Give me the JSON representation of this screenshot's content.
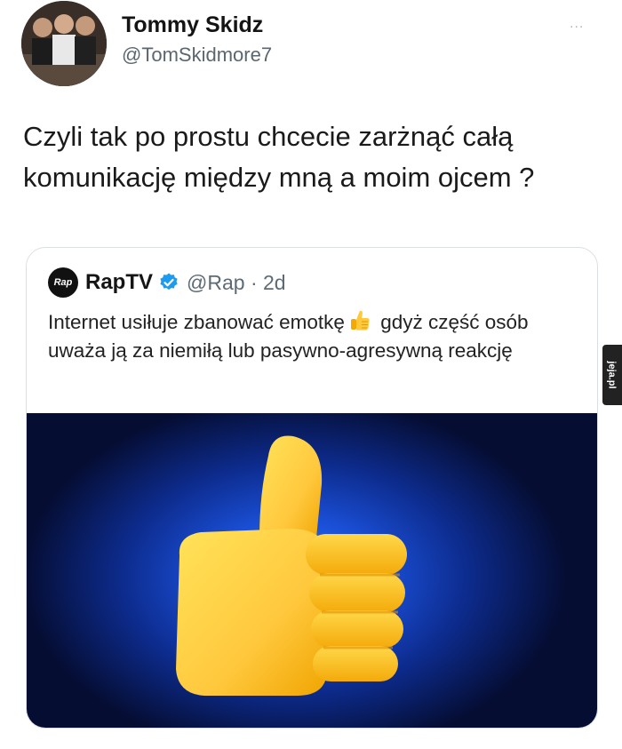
{
  "author": {
    "name": "Tommy Skidz",
    "handle": "@TomSkidmore7"
  },
  "more_menu": "...",
  "tweet": {
    "text": "Czyli tak po prostu chcecie zarżnąć całą komunikację między mną a moim ojcem ?"
  },
  "quoted_tweet": {
    "logo_text": "Rap",
    "name": "RapTV",
    "handle_time": "@Rap · 2d",
    "text_before_emoji": "Internet usiłuje zbanować emotkę",
    "text_after_emoji": " gdyż część osób uważa ją za niemiłą lub pasywno-agresywną reakcję",
    "emoji_icon": "thumbs-up-icon"
  },
  "watermark": "jeja.pl",
  "colors": {
    "verified": "#1d9bf0",
    "emoji_yellow": "#ffc83d",
    "background_blue": "#1a4fd6"
  }
}
